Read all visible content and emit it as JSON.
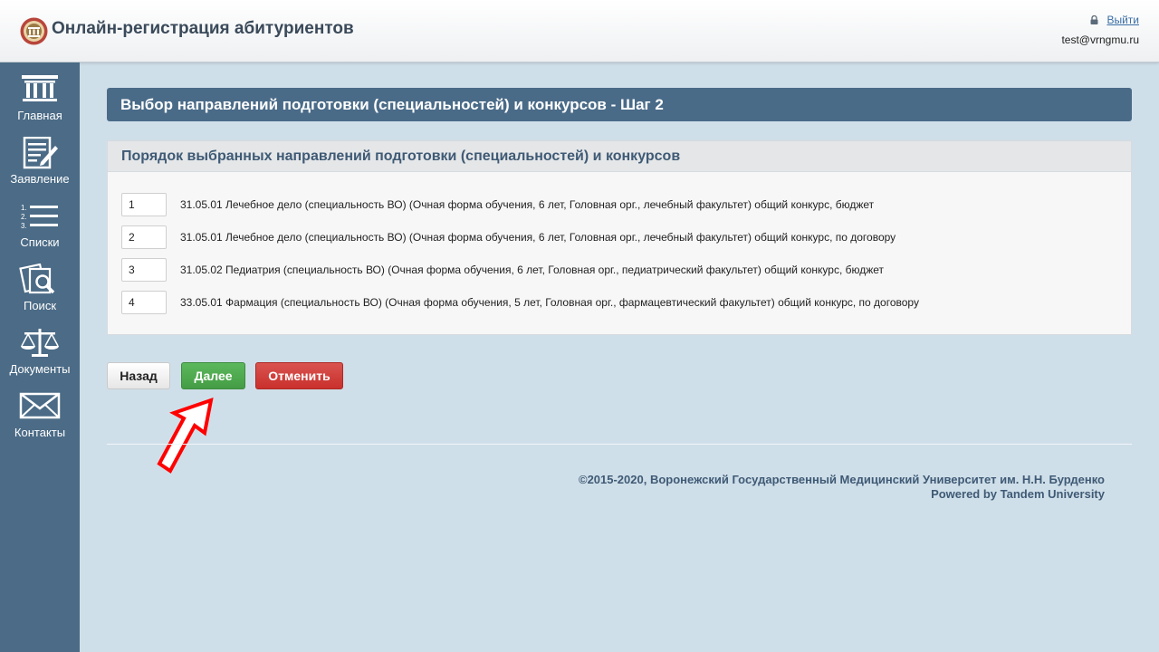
{
  "header": {
    "title": "Онлайн-регистрация абитуриентов",
    "logout_label": "Выйти",
    "user_email": "test@vrngmu.ru"
  },
  "sidebar": {
    "items": [
      {
        "label": "Главная",
        "icon": "bank-icon"
      },
      {
        "label": "Заявление",
        "icon": "application-form-icon"
      },
      {
        "label": "Списки",
        "icon": "numbered-list-icon"
      },
      {
        "label": "Поиск",
        "icon": "search-document-icon"
      },
      {
        "label": "Документы",
        "icon": "scales-icon"
      },
      {
        "label": "Контакты",
        "icon": "envelope-icon"
      }
    ]
  },
  "main": {
    "panel_title": "Выбор направлений подготовки (специальностей) и конкурсов - Шаг 2",
    "order_title": "Порядок выбранных направлений подготовки (специальностей) и конкурсов",
    "rows": [
      {
        "value": "1",
        "text": "31.05.01 Лечебное дело (специальность ВО) (Очная форма обучения, 6 лет, Головная орг., лечебный факультет) общий конкурс, бюджет"
      },
      {
        "value": "2",
        "text": "31.05.01 Лечебное дело (специальность ВО) (Очная форма обучения, 6 лет, Головная орг., лечебный факультет) общий конкурс, по договору"
      },
      {
        "value": "3",
        "text": "31.05.02 Педиатрия (специальность ВО) (Очная форма обучения, 6 лет, Головная орг., педиатрический факультет) общий конкурс, бюджет"
      },
      {
        "value": "4",
        "text": "33.05.01 Фармация (специальность ВО) (Очная форма обучения, 5 лет, Головная орг., фармацевтический факультет) общий конкурс, по договору"
      }
    ]
  },
  "buttons": {
    "back": "Назад",
    "next": "Далее",
    "cancel": "Отменить"
  },
  "footer": {
    "copyright": "©2015-2020, Воронежский Государственный Медицинский Университет им. Н.Н. Бурденко",
    "powered": "Powered by Tandem University"
  },
  "colors": {
    "sidebar": "#4b6b86",
    "panel_title": "#4a6b88",
    "background": "#cfdfe9",
    "next_button": "#5cb85c",
    "cancel_button": "#d9534f",
    "annotation_arrow": "#ff0000"
  }
}
